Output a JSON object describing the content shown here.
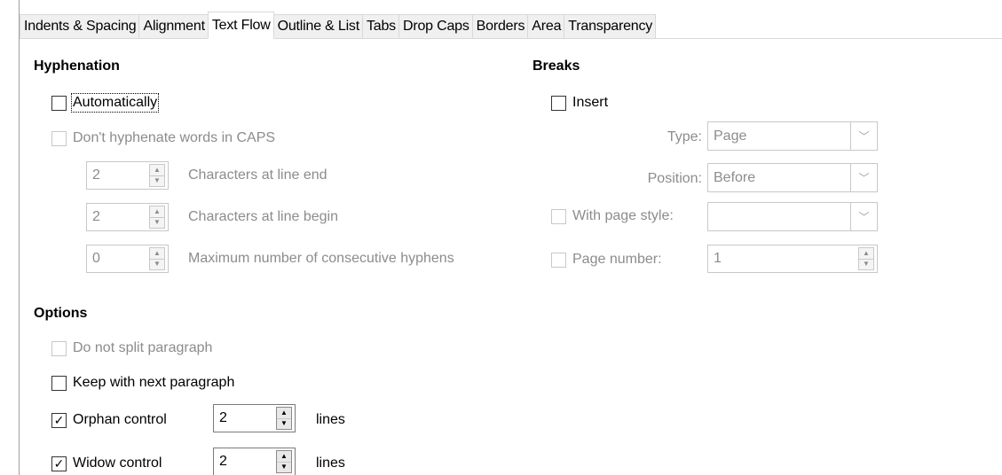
{
  "tabs": [
    "Indents & Spacing",
    "Alignment",
    "Text Flow",
    "Outline & List",
    "Tabs",
    "Drop Caps",
    "Borders",
    "Area",
    "Transparency"
  ],
  "active_tab": "Text Flow",
  "hyphenation": {
    "heading": "Hyphenation",
    "automatically": "Automatically",
    "dont_hyphenate_caps": "Don't hyphenate words in CAPS",
    "chars_line_end_value": "2",
    "chars_line_end_label": "Characters at line end",
    "chars_line_begin_value": "2",
    "chars_line_begin_label": "Characters at line begin",
    "max_hyphens_value": "0",
    "max_hyphens_label": "Maximum number of consecutive hyphens"
  },
  "breaks": {
    "heading": "Breaks",
    "insert": "Insert",
    "type_label": "Type:",
    "type_value": "Page",
    "position_label": "Position:",
    "position_value": "Before",
    "with_page_style": "With page style:",
    "with_page_style_value": "",
    "page_number": "Page number:",
    "page_number_value": "1"
  },
  "options": {
    "heading": "Options",
    "do_not_split": "Do not split paragraph",
    "keep_with_next": "Keep with next paragraph",
    "orphan_control": "Orphan control",
    "orphan_value": "2",
    "orphan_unit": "lines",
    "widow_control": "Widow control",
    "widow_value": "2",
    "widow_unit": "lines"
  },
  "glyphs": {
    "check": "✓",
    "up": "▲",
    "down": "▼",
    "chevron": "﹀"
  }
}
